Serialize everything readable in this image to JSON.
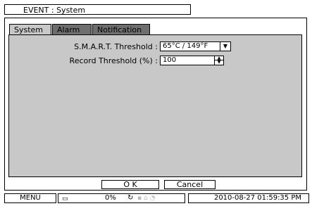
{
  "window": {
    "title": "EVENT : System"
  },
  "tabs": [
    {
      "label": "System",
      "active": true
    },
    {
      "label": "Alarm",
      "active": false
    },
    {
      "label": "Notification",
      "active": false
    }
  ],
  "form": {
    "smart_threshold": {
      "label": "S.M.A.R.T. Threshold :",
      "value": "65°C / 149°F",
      "control": "dropdown"
    },
    "record_threshold": {
      "label": "Record Threshold (%) :",
      "value": "100",
      "control": "spinner"
    }
  },
  "buttons": {
    "ok": "O K",
    "cancel": "Cancel"
  },
  "status_bar": {
    "menu": "MENU",
    "percent": "0%",
    "datetime": "2010-08-27 01:59:35 PM"
  },
  "colors": {
    "panel": "#c8c8c8",
    "tab_inactive": "#6e6e6e",
    "frame": "#000000"
  },
  "icons": [
    "monitor-icon",
    "refresh-icon",
    "chevron-down-icon",
    "spinner-up-icon",
    "spinner-down-icon"
  ]
}
